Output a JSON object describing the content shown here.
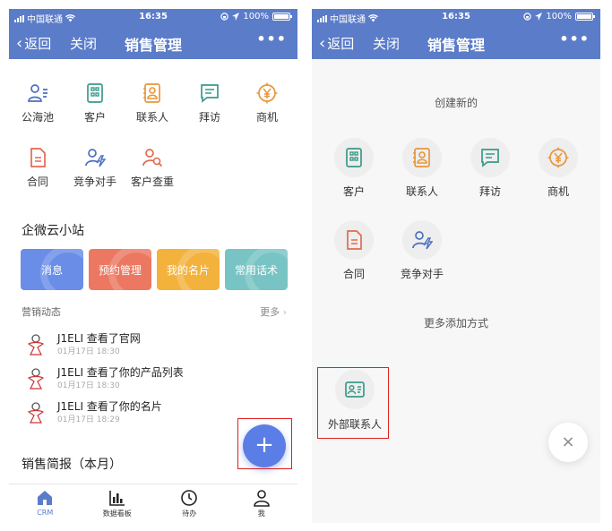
{
  "colors": {
    "brand_blue": "#5b7cc9",
    "fab_blue": "#5b7ee6",
    "highlight_red": "#e02020",
    "icon_blue": "#4a6fc2",
    "icon_green": "#3a9a8a",
    "icon_orange": "#e8963a",
    "icon_red": "#e26a4e",
    "tile_blue": "#6a8de8",
    "tile_red": "#ec7862",
    "tile_orange": "#f3b23c",
    "tile_teal": "#78c4c4"
  },
  "status_bar": {
    "carrier": "中国联通",
    "time": "16:35",
    "battery": "100%"
  },
  "left": {
    "navbar": {
      "back": "返回",
      "close": "关闭",
      "title": "销售管理",
      "more": "•••"
    },
    "apps_row1": [
      {
        "label": "公海池",
        "icon": "public-pool-icon"
      },
      {
        "label": "客户",
        "icon": "building-icon"
      },
      {
        "label": "联系人",
        "icon": "contact-card-icon"
      },
      {
        "label": "拜访",
        "icon": "chat-icon"
      },
      {
        "label": "商机",
        "icon": "yen-coin-icon"
      }
    ],
    "apps_row2": [
      {
        "label": "合同",
        "icon": "document-icon"
      },
      {
        "label": "竞争对手",
        "icon": "rival-icon"
      },
      {
        "label": "客户查重",
        "icon": "person-search-icon"
      }
    ],
    "site_title": "企微云小站",
    "tiles": [
      "消息",
      "预约管理",
      "我的名片",
      "常用话术"
    ],
    "feed_title": "营销动态",
    "feed_more": "更多",
    "feed": [
      {
        "text": "J1ELI 查看了官网",
        "date": "01月17日 18:30"
      },
      {
        "text": "J1ELI 查看了你的产品列表",
        "date": "01月17日 18:30"
      },
      {
        "text": "J1ELI 查看了你的名片",
        "date": "01月17日 18:29"
      }
    ],
    "report_title": "销售简报（本月）",
    "fab": "+",
    "tabs": [
      {
        "label": "CRM",
        "icon": "home-icon"
      },
      {
        "label": "数据看板",
        "icon": "bar-chart-icon"
      },
      {
        "label": "待办",
        "icon": "clock-icon"
      },
      {
        "label": "我",
        "icon": "person-icon"
      }
    ]
  },
  "right": {
    "navbar": {
      "back": "返回",
      "close": "关闭",
      "title": "销售管理",
      "more": "•••"
    },
    "create_title": "创建新的",
    "row1": [
      {
        "label": "客户",
        "icon": "building-icon"
      },
      {
        "label": "联系人",
        "icon": "contact-card-icon"
      },
      {
        "label": "拜访",
        "icon": "chat-icon"
      },
      {
        "label": "商机",
        "icon": "yen-coin-icon"
      }
    ],
    "row2": [
      {
        "label": "合同",
        "icon": "document-icon"
      },
      {
        "label": "竞争对手",
        "icon": "rival-icon"
      }
    ],
    "more_add": "更多添加方式",
    "external": {
      "label": "外部联系人",
      "icon": "id-card-icon"
    },
    "close": "×"
  }
}
